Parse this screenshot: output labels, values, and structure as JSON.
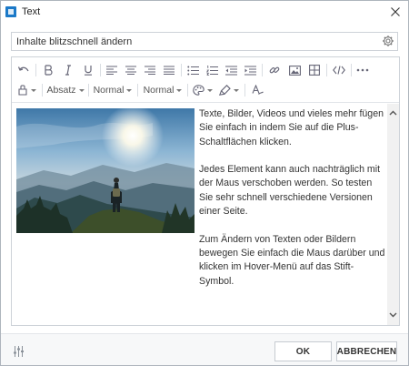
{
  "window": {
    "title": "Text",
    "accent_color": "#1b79c8"
  },
  "name_field": {
    "value": "Inhalte blitzschnell ändern",
    "icon": "gear-icon"
  },
  "toolbar": {
    "row1_icons": [
      "undo-icon",
      "bold-icon",
      "italic-icon",
      "underline-icon",
      "align-left-icon",
      "align-center-icon",
      "align-right-icon",
      "align-justify-icon",
      "bulleted-list-icon",
      "numbered-list-icon",
      "outdent-icon",
      "indent-icon",
      "link-icon",
      "image-icon",
      "table-icon",
      "code-icon",
      "more-icon"
    ],
    "paragraph_label": "Absatz",
    "font_size_label": "Normal",
    "font_family_label": "Normal"
  },
  "content": {
    "paragraphs": [
      "Texte, Bilder, Videos und vieles mehr fügen Sie einfach in indem Sie auf die Plus-Schaltflächen klicken.",
      "Jedes Element kann auch nachträglich mit der Maus verschoben werden. So testen Sie sehr schnell verschiedene Versionen einer Seite.",
      "Zum Ändern von Texten oder Bildern bewegen Sie einfach die Maus darüber und klicken im Hover-Menü auf das Stift-Symbol."
    ]
  },
  "footer": {
    "ok_label": "OK",
    "cancel_label": "ABBRECHEN"
  }
}
